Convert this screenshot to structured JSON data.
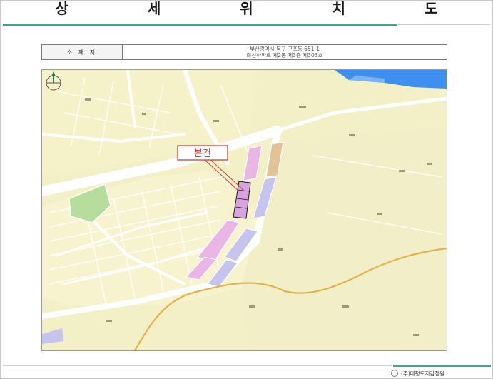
{
  "title": "상 세 위 치 도",
  "location": {
    "label": "소 재 지",
    "address_line1": "부산광역시 북구 구포동 651-1",
    "address_line2": "화신아파트 제2동 제3층 제303호"
  },
  "map": {
    "callout_label": "본건",
    "colors": {
      "base": "#f3efc6",
      "road": "#ffffff",
      "park": "#b6dc9e",
      "river": "#3f8ff0",
      "zone_pink": "#e9b6e6",
      "zone_blue": "#c7c3ef",
      "zone_tan": "#e2c398",
      "stream": "#e6b04a",
      "callout": "#d03030"
    }
  },
  "footer": {
    "company": "(주)대평토지감정원"
  }
}
